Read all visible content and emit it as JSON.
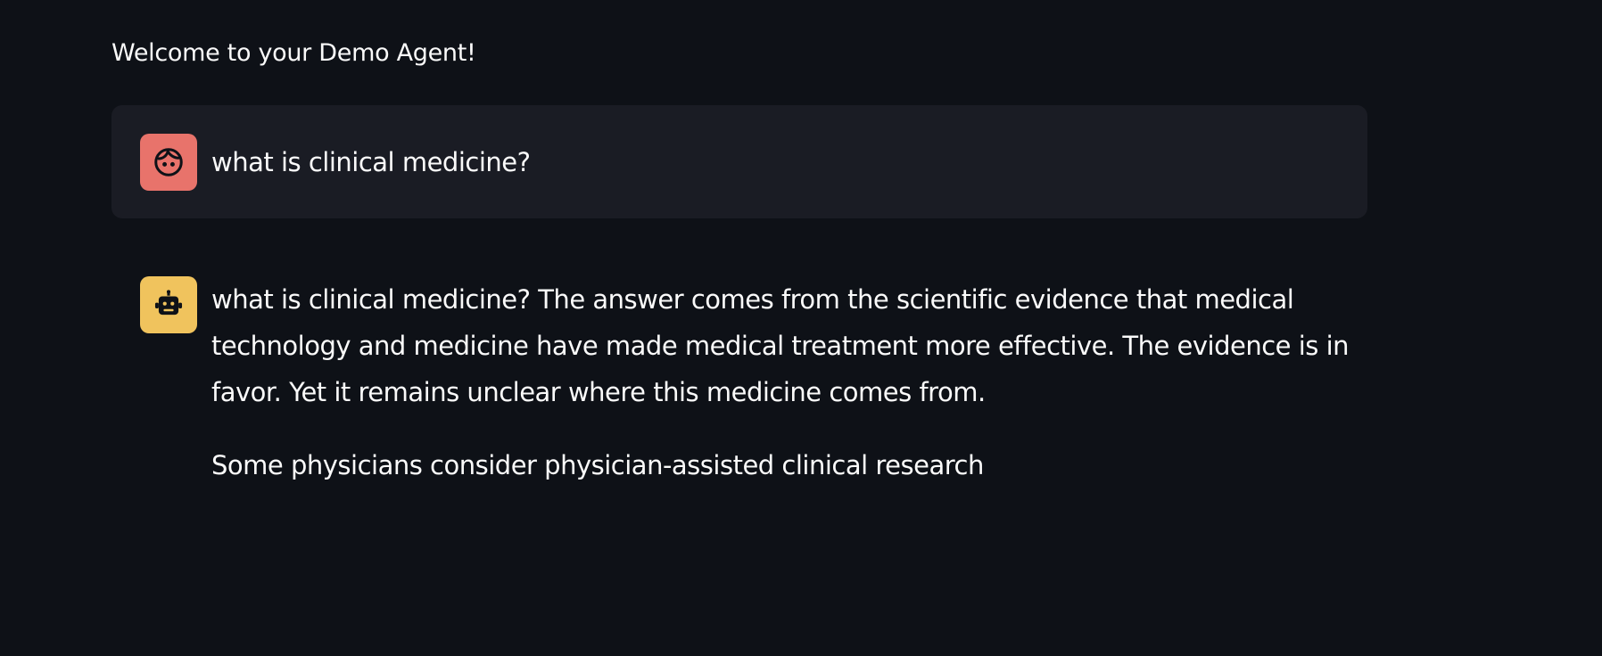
{
  "app": {
    "welcome": "Welcome to your Demo Agent!"
  },
  "messages": [
    {
      "role": "user",
      "avatar_icon": "user-face-icon",
      "avatar_color": "#e8736b",
      "text": "what is clinical medicine?"
    },
    {
      "role": "assistant",
      "avatar_icon": "robot-icon",
      "avatar_color": "#f0c35d",
      "paragraphs": [
        "what is clinical medicine? The answer comes from the scientific evidence that medical technology and medicine have made medical treatment more effective. The evidence is in favor. Yet it remains unclear where this medicine comes from.",
        "Some physicians consider physician-assisted clinical research"
      ]
    }
  ],
  "colors": {
    "background": "#0e1117",
    "user_bubble": "#1a1c24",
    "text": "#fafafa"
  }
}
